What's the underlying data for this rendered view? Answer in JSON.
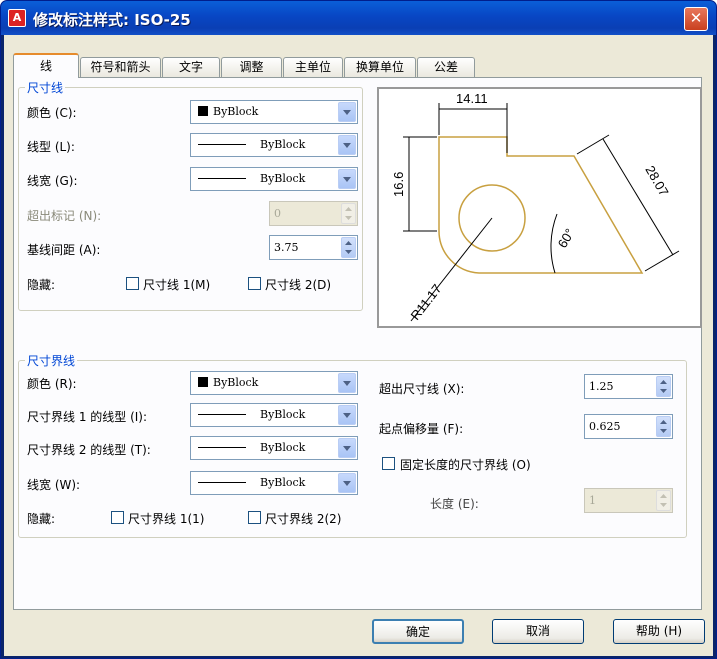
{
  "window": {
    "title": "修改标注样式: ISO-25",
    "app_icon": "A",
    "close_icon": "close-icon"
  },
  "tabs": [
    "线",
    "符号和箭头",
    "文字",
    "调整",
    "主单位",
    "换算单位",
    "公差"
  ],
  "dim_lines": {
    "title": "尺寸线",
    "color_label": "颜色 (C):",
    "color_value": "ByBlock",
    "linetype_label": "线型 (L):",
    "linetype_value": "ByBlock",
    "lineweight_label": "线宽 (G):",
    "lineweight_value": "ByBlock",
    "extend_ticks_label": "超出标记 (N):",
    "extend_ticks_value": "0",
    "baseline_spacing_label": "基线间距 (A):",
    "baseline_spacing_value": "3.75",
    "suppress_label": "隐藏:",
    "suppress_1": "尺寸线 1(M)",
    "suppress_2": "尺寸线 2(D)"
  },
  "preview": {
    "dim_top": "14.11",
    "dim_left": "16.6",
    "dim_diag": "28.07",
    "dim_angle": "60°",
    "dim_radius": "R11.17"
  },
  "ext_lines": {
    "title": "尺寸界线",
    "color_label": "颜色 (R):",
    "color_value": "ByBlock",
    "ext1_linetype_label": "尺寸界线 1 的线型 (I):",
    "ext1_linetype_value": "ByBlock",
    "ext2_linetype_label": "尺寸界线 2 的线型 (T):",
    "ext2_linetype_value": "ByBlock",
    "lineweight_label": "线宽 (W):",
    "lineweight_value": "ByBlock",
    "suppress_label": "隐藏:",
    "suppress_1": "尺寸界线 1(1)",
    "suppress_2": "尺寸界线 2(2)",
    "extend_label": "超出尺寸线 (X):",
    "extend_value": "1.25",
    "offset_label": "起点偏移量 (F):",
    "offset_value": "0.625",
    "fixed_length_label": "固定长度的尺寸界线 (O)",
    "length_label": "长度 (E):",
    "length_value": "1"
  },
  "buttons": {
    "ok": "确定",
    "cancel": "取消",
    "help": "帮助 (H)"
  },
  "colors": {
    "titlebar": "#0a4fd0",
    "dialog_bg": "#ece9d8",
    "group_title": "#0046d5",
    "preview_geometry": "#c8a040",
    "preview_dims": "#000000"
  }
}
